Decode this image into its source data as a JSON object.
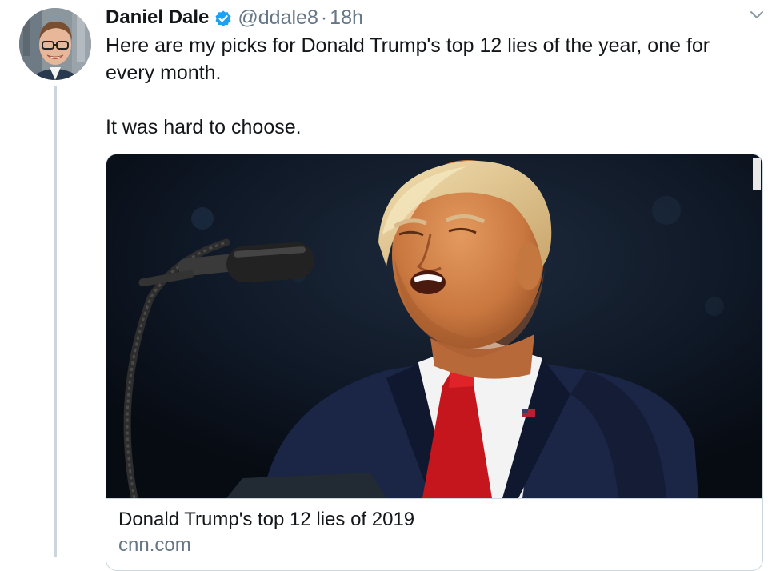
{
  "tweet": {
    "display_name": "Daniel Dale",
    "handle": "@ddale8",
    "separator": "·",
    "time": "18h",
    "text_line_1": "Here are my picks for Donald Trump's top 12 lies of the year, one for every month.",
    "text_line_2": "It was hard to choose."
  },
  "card": {
    "title": "Donald Trump's top 12 lies of 2019",
    "domain": "cnn.com"
  },
  "icons": {
    "verified": "verified-badge-icon",
    "caret": "chevron-down-icon"
  },
  "colors": {
    "verified_blue": "#1da1f2",
    "secondary_text": "#657786",
    "border": "#ccd6dd"
  }
}
